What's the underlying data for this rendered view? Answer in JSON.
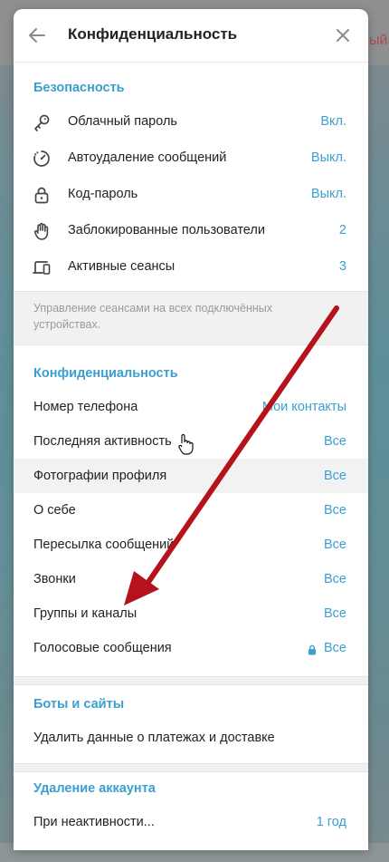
{
  "background": {
    "right_text": "ый"
  },
  "header": {
    "title": "Конфиденциальность"
  },
  "security": {
    "title": "Безопасность",
    "items": [
      {
        "label": "Облачный пароль",
        "value": "Вкл.",
        "icon": "key-icon"
      },
      {
        "label": "Автоудаление сообщений",
        "value": "Выкл.",
        "icon": "timer-icon"
      },
      {
        "label": "Код-пароль",
        "value": "Выкл.",
        "icon": "lock-icon"
      },
      {
        "label": "Заблокированные пользователи",
        "value": "2",
        "icon": "hand-stop-icon"
      },
      {
        "label": "Активные сеансы",
        "value": "3",
        "icon": "devices-icon"
      }
    ],
    "note": "Управление сеансами на всех подключённых устройствах."
  },
  "privacy": {
    "title": "Конфиденциальность",
    "items": [
      {
        "label": "Номер телефона",
        "value": "Мои контакты"
      },
      {
        "label": "Последняя активность",
        "value": "Все"
      },
      {
        "label": "Фотографии профиля",
        "value": "Все"
      },
      {
        "label": "О себе",
        "value": "Все"
      },
      {
        "label": "Пересылка сообщений",
        "value": "Все"
      },
      {
        "label": "Звонки",
        "value": "Все"
      },
      {
        "label": "Группы и каналы",
        "value": "Все"
      },
      {
        "label": "Голосовые сообщения",
        "value": "Все",
        "locked": true
      }
    ]
  },
  "bots": {
    "title": "Боты и сайты",
    "items": [
      {
        "label": "Удалить данные о платежах и доставке"
      }
    ]
  },
  "account_deletion": {
    "title": "Удаление аккаунта",
    "items": [
      {
        "label": "При неактивности...",
        "value": "1 год"
      }
    ]
  },
  "colors": {
    "accent": "#3a9fd1",
    "arrow": "#b5121b"
  }
}
